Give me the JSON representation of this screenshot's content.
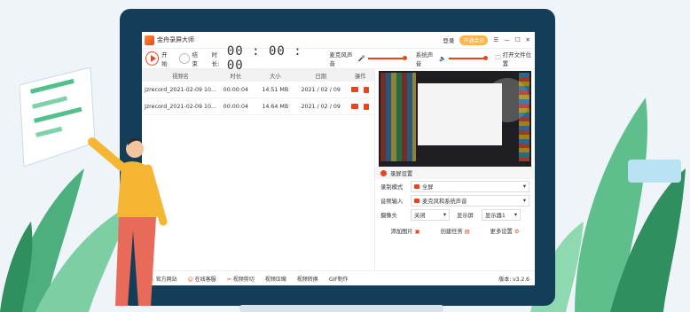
{
  "app": {
    "title": "金舟录屏大师",
    "login": "登录",
    "vip": "开通会员"
  },
  "toolbar": {
    "start": "开始",
    "stop": "结束",
    "duration_label": "时长:",
    "timer": "00 : 00 : 00",
    "mic_label": "麦克风声音",
    "system_label": "系统声音",
    "open_folder": "打开文件位置"
  },
  "table": {
    "headers": [
      "视频名",
      "时长",
      "大小",
      "日期",
      "操作"
    ],
    "rows": [
      {
        "name": "Jzrecord_2021-02-09 10...",
        "duration": "00:00:04",
        "size": "14.51 MB",
        "date": "2021 / 02 / 09"
      },
      {
        "name": "Jzrecord_2021-02-09 10...",
        "duration": "00:00:04",
        "size": "14.64 MB",
        "date": "2021 / 02 / 09"
      }
    ]
  },
  "settings": {
    "title": "录屏设置",
    "mode_label": "录制模式",
    "mode_value": "全屏",
    "audio_label": "音频输入",
    "audio_value": "麦克风和系统声音",
    "camera_label": "摄像头",
    "camera_value": "关闭",
    "display_label": "显示屏",
    "display_value": "显示器1",
    "add_image": "添加图片",
    "create_task": "创建任务",
    "more_settings": "更多设置"
  },
  "footer": {
    "items": [
      "官方网站",
      "在线客服",
      "视频剪切",
      "视频压缩",
      "视频转换",
      "GIF制作"
    ],
    "version": "版本: v3.2.6"
  },
  "colors": {
    "accent": "#e8451c",
    "monitor": "#143d5a"
  }
}
